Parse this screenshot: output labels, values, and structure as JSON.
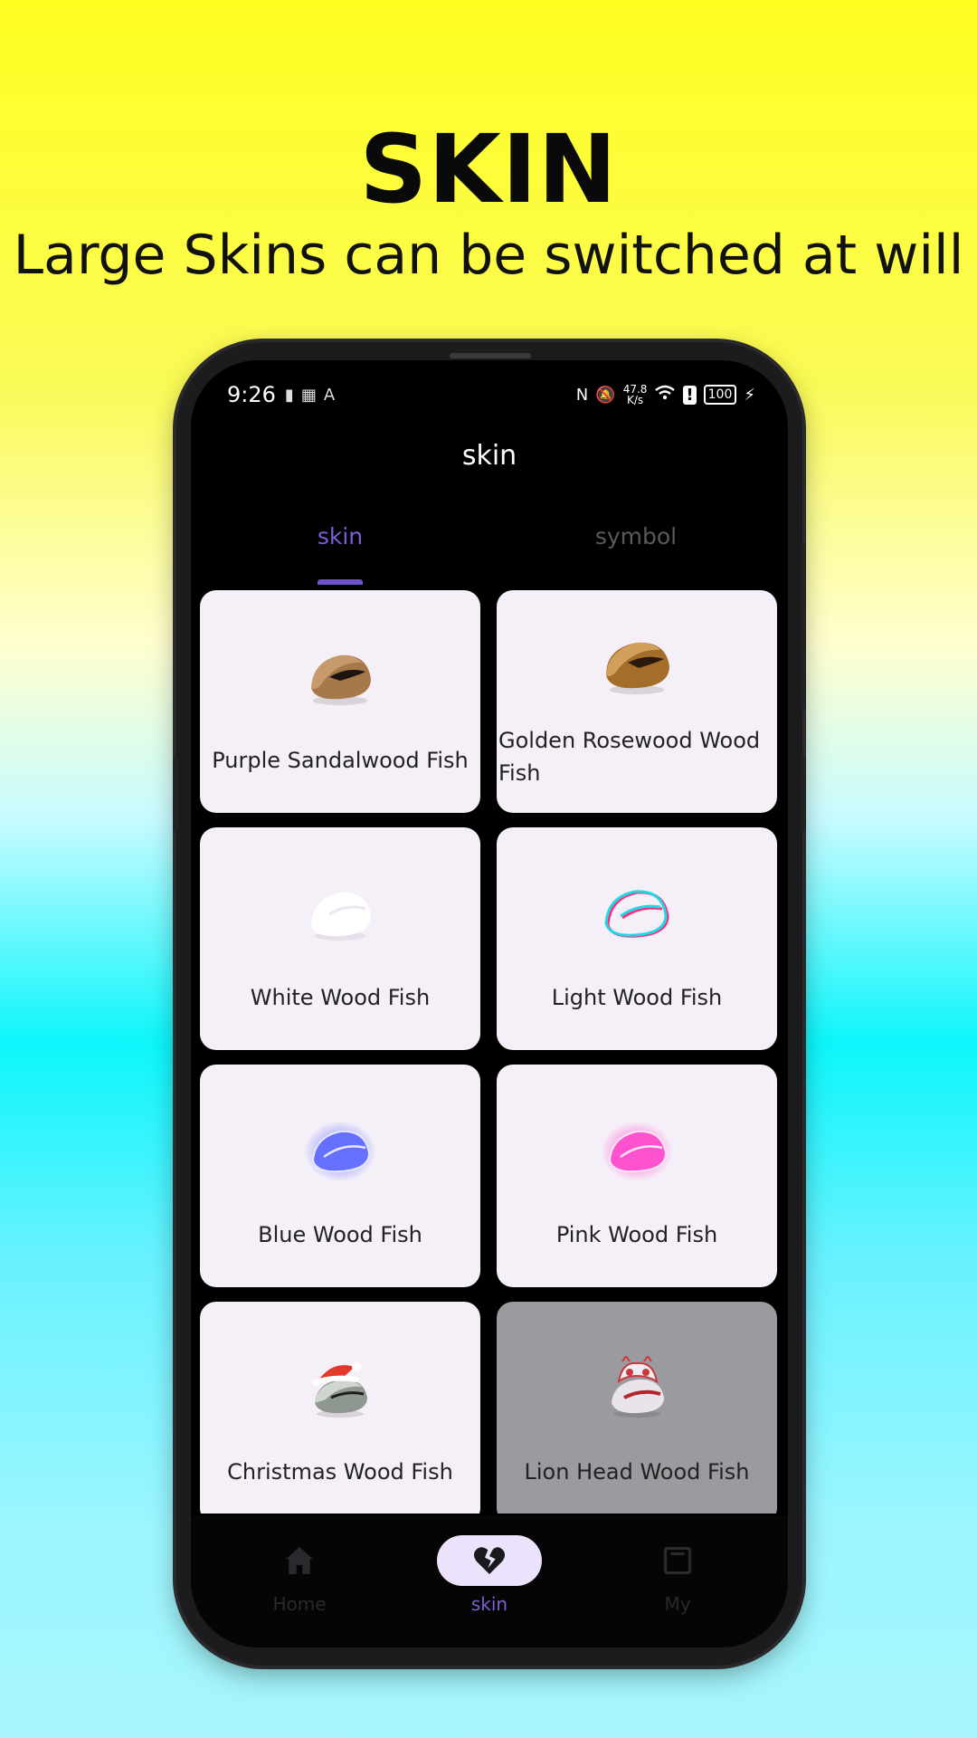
{
  "promo": {
    "title": "SKIN",
    "subtitle": "Large Skins can be switched at will"
  },
  "status_bar": {
    "time": "9:26",
    "speed_value": "47.8",
    "speed_unit": "K/s",
    "battery": "100"
  },
  "screen": {
    "title": "skin"
  },
  "tabs": [
    {
      "label": "skin",
      "active": true
    },
    {
      "label": "symbol",
      "active": false
    }
  ],
  "skins": [
    {
      "label": "Purple Sandalwood Fish",
      "icon": "brown-wood-fish-icon"
    },
    {
      "label": "Golden Rosewood Wood Fish",
      "icon": "golden-wood-fish-icon"
    },
    {
      "label": "White Wood Fish",
      "icon": "white-wood-fish-icon"
    },
    {
      "label": "Light Wood Fish",
      "icon": "light-wood-fish-icon"
    },
    {
      "label": "Blue Wood Fish",
      "icon": "blue-wood-fish-icon"
    },
    {
      "label": "Pink Wood Fish",
      "icon": "pink-wood-fish-icon"
    },
    {
      "label": "Christmas Wood Fish",
      "icon": "christmas-wood-fish-icon"
    },
    {
      "label": "Lion Head Wood Fish",
      "icon": "lion-head-wood-fish-icon"
    }
  ],
  "bottom_nav": [
    {
      "label": "Home",
      "icon": "home-icon"
    },
    {
      "label": "skin",
      "icon": "broken-heart-icon",
      "active": true
    },
    {
      "label": "My",
      "icon": "window-icon"
    }
  ],
  "colors": {
    "accent": "#7b5fd0",
    "card_bg": "#f5f0f8",
    "locked_card_bg": "#9b9a9f"
  }
}
